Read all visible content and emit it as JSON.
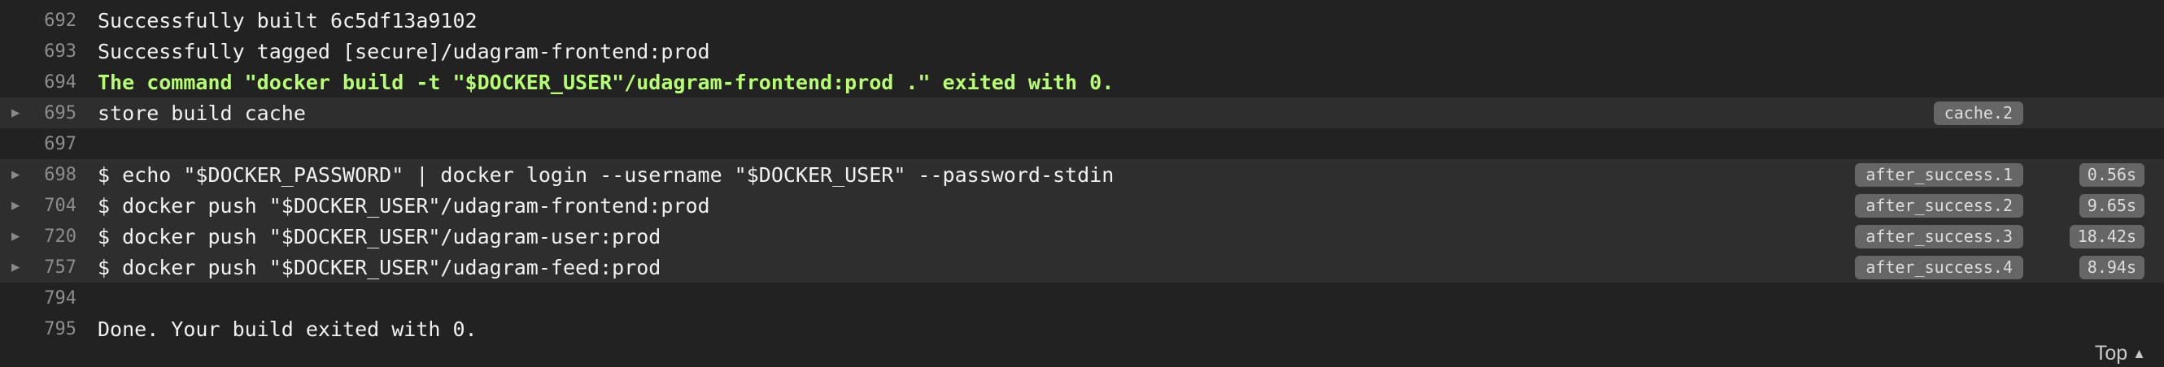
{
  "lines": [
    {
      "num": "692",
      "text": "Successfully built 6c5df13a9102"
    },
    {
      "num": "693",
      "text": "Successfully tagged [secure]/udagram-frontend:prod"
    },
    {
      "num": "694",
      "text": "The command \"docker build -t \"$DOCKER_USER\"/udagram-frontend:prod .\" exited with 0."
    },
    {
      "num": "695",
      "text": "store build cache",
      "tag": "cache.2"
    },
    {
      "num": "697",
      "text": ""
    },
    {
      "num": "698",
      "text": "$ echo \"$DOCKER_PASSWORD\" | docker login --username \"$DOCKER_USER\" --password-stdin",
      "tag": "after_success.1",
      "duration": "0.56s"
    },
    {
      "num": "704",
      "text": "$ docker push \"$DOCKER_USER\"/udagram-frontend:prod",
      "tag": "after_success.2",
      "duration": "9.65s"
    },
    {
      "num": "720",
      "text": "$ docker push \"$DOCKER_USER\"/udagram-user:prod",
      "tag": "after_success.3",
      "duration": "18.42s"
    },
    {
      "num": "757",
      "text": "$ docker push \"$DOCKER_USER\"/udagram-feed:prod",
      "tag": "after_success.4",
      "duration": "8.94s"
    },
    {
      "num": "794",
      "text": ""
    },
    {
      "num": "795",
      "text": "Done. Your build exited with 0."
    }
  ],
  "fold_arrow": "▶",
  "top_link": {
    "label": "Top",
    "icon": "caret-up-icon",
    "glyph": "▲"
  },
  "colors": {
    "background": "#222222",
    "fold_background": "#2e2e2e",
    "success_text": "#b6ff70",
    "tag_background": "#666666"
  }
}
